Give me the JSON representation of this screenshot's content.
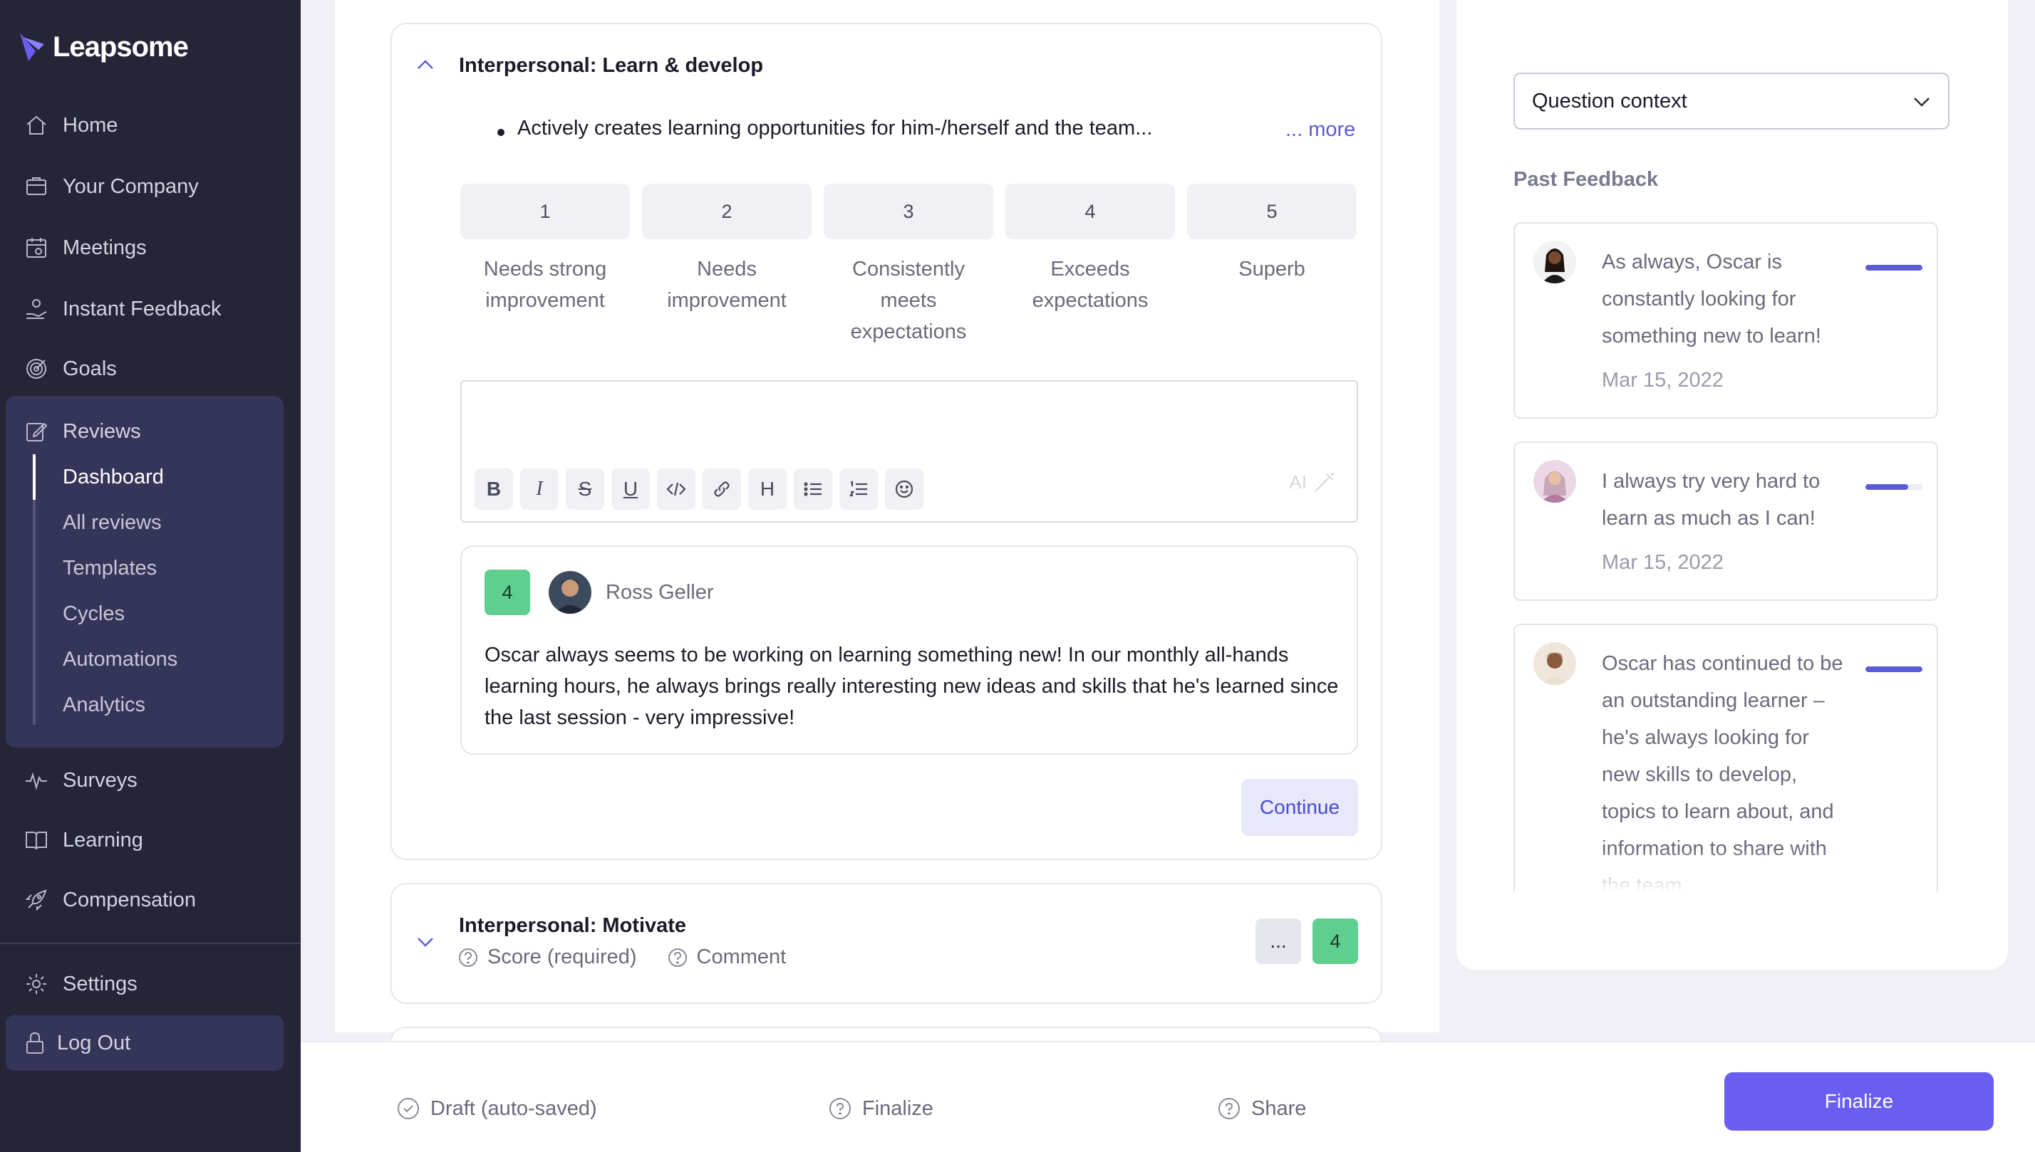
{
  "app": {
    "name": "Leapsome",
    "accent": "#5b5bd6",
    "sidebar_bg": "#262538"
  },
  "sidebar": {
    "items": [
      {
        "label": "Home",
        "icon": "home-icon"
      },
      {
        "label": "Your Company",
        "icon": "building-icon"
      },
      {
        "label": "Meetings",
        "icon": "calendar-icon"
      },
      {
        "label": "Instant Feedback",
        "icon": "feedback-hand-icon"
      },
      {
        "label": "Goals",
        "icon": "target-icon"
      },
      {
        "label": "Reviews",
        "icon": "edit-icon"
      },
      {
        "label": "Surveys",
        "icon": "pulse-icon"
      },
      {
        "label": "Learning",
        "icon": "book-icon"
      },
      {
        "label": "Compensation",
        "icon": "rocket-icon"
      },
      {
        "label": "Settings",
        "icon": "gear-icon"
      }
    ],
    "reviews_subitems": [
      "Dashboard",
      "All reviews",
      "Templates",
      "Cycles",
      "Automations",
      "Analytics"
    ],
    "active_subitem": "Dashboard",
    "logout": "Log Out"
  },
  "section1": {
    "title": "Interpersonal: Learn & develop",
    "bullet": "Actively creates learning opportunities for him-/herself and the team...",
    "more": "... more",
    "scale": [
      {
        "value": "1",
        "label": "Needs strong improvement"
      },
      {
        "value": "2",
        "label": "Needs improvement"
      },
      {
        "value": "3",
        "label": "Consistently meets expectations"
      },
      {
        "value": "4",
        "label": "Exceeds expectations"
      },
      {
        "value": "5",
        "label": "Superb"
      }
    ],
    "editor": {
      "tools": [
        "B",
        "I",
        "S",
        "U",
        "code",
        "link",
        "H",
        "bullet-list",
        "numbered-list",
        "emoji"
      ],
      "ai_hint": "AI"
    },
    "comment": {
      "score": "4",
      "author": "Ross Geller",
      "text": "Oscar always seems to be working on learning something new! In our monthly all-hands learning hours, he always brings really interesting new ideas and skills that he's learned since the last session - very impressive!"
    },
    "continue_label": "Continue"
  },
  "section2": {
    "title": "Interpersonal: Motivate",
    "meta": [
      "Score (required)",
      "Comment"
    ],
    "dots": "...",
    "score": "4"
  },
  "right_panel": {
    "select_value": "Question context",
    "past_feedback_title": "Past Feedback",
    "feedback": [
      {
        "text": "As always, Oscar is constantly looking for something new to learn!",
        "date": "Mar 15, 2022",
        "level": 1.0
      },
      {
        "text": "I always try very hard to learn as much as I can!",
        "date": "Mar 15, 2022",
        "level": 0.75
      },
      {
        "text": "Oscar has continued to be an outstanding learner – he's always looking for new skills to develop, topics to learn about, and information to share with the team.",
        "date": "",
        "level": 1.0
      }
    ]
  },
  "footer": {
    "status": "Draft (auto-saved)",
    "step_finalize": "Finalize",
    "step_share": "Share",
    "finalize_button": "Finalize"
  }
}
